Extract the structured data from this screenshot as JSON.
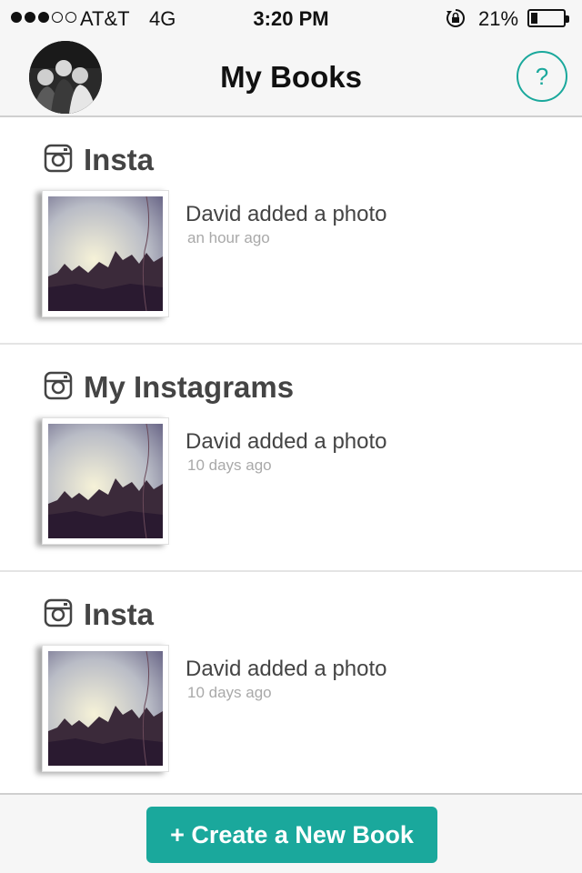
{
  "status_bar": {
    "signal_dots": [
      true,
      true,
      true,
      false,
      false
    ],
    "carrier": "AT&T",
    "network": "4G",
    "time": "3:20 PM",
    "battery_percent_label": "21%",
    "battery_level": 0.21,
    "icons": [
      "orientation-lock-icon",
      "battery-icon"
    ]
  },
  "nav": {
    "title": "My Books",
    "help_label": "?",
    "avatar_icon": "profile-photo"
  },
  "books": [
    {
      "title": "Insta",
      "icon": "instagram-icon",
      "activity": "David added a photo",
      "time": "an hour ago"
    },
    {
      "title": "My Instagrams",
      "icon": "instagram-icon",
      "activity": "David added a photo",
      "time": "10 days ago"
    },
    {
      "title": "Insta",
      "icon": "instagram-icon",
      "activity": "David added a photo",
      "time": "10 days ago"
    }
  ],
  "bottom": {
    "create_label": "+ Create a New Book"
  },
  "colors": {
    "accent": "#1aa89c",
    "bar_background": "#f6f6f6",
    "secondary_text": "#a9a9a9"
  }
}
